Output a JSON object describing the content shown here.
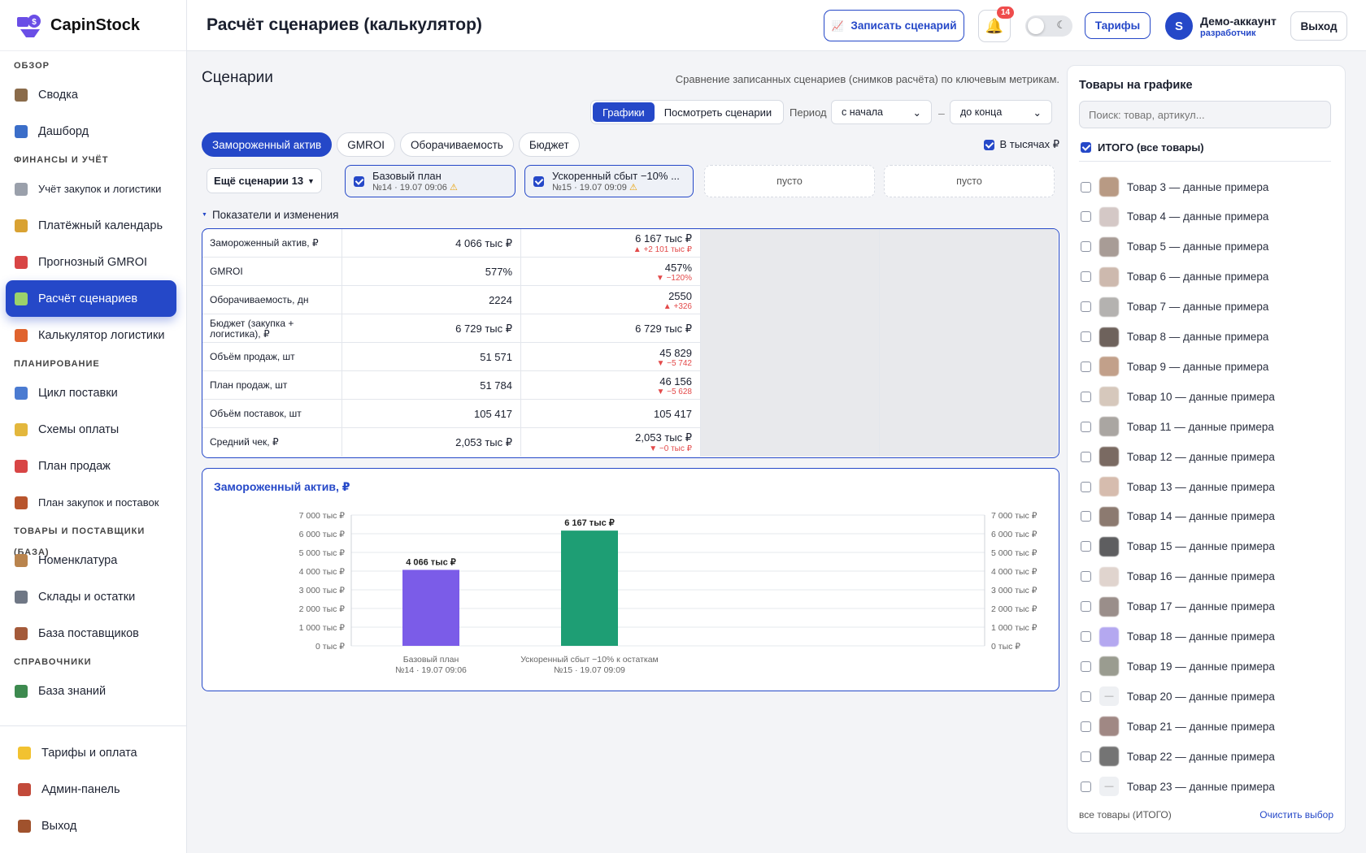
{
  "brand": {
    "name": "CapinStock"
  },
  "sidebar": {
    "sections": [
      {
        "title": "ОБЗОР",
        "items": [
          {
            "label": "Сводка",
            "icon": "notebook-icon",
            "color": "#8a6b4a"
          },
          {
            "label": "Дашборд",
            "icon": "bar-chart-icon",
            "color": "#3b6ec9"
          }
        ]
      },
      {
        "title": "ФИНАНСЫ И УЧЁТ",
        "items": [
          {
            "label": "Учёт закупок и логистики",
            "icon": "receipt-icon",
            "color": "#9aa0ab"
          },
          {
            "label": "Платёжный календарь",
            "icon": "money-bag-icon",
            "color": "#d9a233"
          },
          {
            "label": "Прогнозный GMROI",
            "icon": "target-icon",
            "color": "#d84545"
          },
          {
            "label": "Расчёт сценариев",
            "icon": "pencil-icon",
            "color": "#9bd26a",
            "active": true
          },
          {
            "label": "Калькулятор логистики",
            "icon": "truck-icon",
            "color": "#e0632e"
          }
        ]
      },
      {
        "title": "ПЛАНИРОВАНИЕ",
        "items": [
          {
            "label": "Цикл поставки",
            "icon": "cycle-icon",
            "color": "#4b7bd1"
          },
          {
            "label": "Схемы оплаты",
            "icon": "credit-card-icon",
            "color": "#e3b73d"
          },
          {
            "label": "План продаж",
            "icon": "line-chart-icon",
            "color": "#d84545"
          },
          {
            "label": "План закупок и поставок",
            "icon": "bricks-icon",
            "color": "#b8552d"
          }
        ]
      },
      {
        "title": "ТОВАРЫ И ПОСТАВЩИКИ (БАЗА)",
        "items": [
          {
            "label": "Номенклатура",
            "icon": "box-icon",
            "color": "#b9844d"
          },
          {
            "label": "Склады и остатки",
            "icon": "building-icon",
            "color": "#6f7785"
          },
          {
            "label": "База поставщиков",
            "icon": "factory-icon",
            "color": "#a45a3a"
          }
        ]
      },
      {
        "title": "СПРАВОЧНИКИ",
        "items": [
          {
            "label": "База знаний",
            "icon": "books-icon",
            "color": "#3d8a4f"
          }
        ]
      }
    ],
    "bottom": [
      {
        "label": "Тарифы и оплата",
        "icon": "star-icon",
        "color": "#f2c230"
      },
      {
        "label": "Админ-панель",
        "icon": "shield-icon",
        "color": "#c24a3a"
      },
      {
        "label": "Выход",
        "icon": "door-icon",
        "color": "#a0522d"
      }
    ]
  },
  "header": {
    "title": "Расчёт сценариев (калькулятор)",
    "record_button": "Записать сценарий",
    "notifications_count": "14",
    "tariffs_button": "Тарифы",
    "avatar_letter": "S",
    "account_name": "Демо-аккаунт",
    "account_role": "разработчик",
    "logout_button": "Выход"
  },
  "scenarios": {
    "title": "Сценарии",
    "subtitle": "Сравнение записанных сценариев (снимков расчёта) по ключевым метрикам.",
    "view_tabs": [
      "Графики",
      "Посмотреть сценарии"
    ],
    "period_label": "Период",
    "period_from": "с начала",
    "period_to": "до конца",
    "metric_tabs": [
      "Замороженный актив",
      "GMROI",
      "Оборачиваемость",
      "Бюджет"
    ],
    "thousands_label": "В тысячах ₽",
    "more_button": "Ещё сценарии 13",
    "slots": [
      {
        "name": "Базовый план",
        "meta": "№14 · 19.07 09:06"
      },
      {
        "name": "Ускоренный сбыт −10% ...",
        "meta": "№15 · 19.07 09:09"
      }
    ],
    "empty_label": "пусто",
    "metrics_header": "Показатели и изменения"
  },
  "metrics": [
    {
      "label": "Замороженный актив, ₽",
      "v1": "4 066 тыс ₽",
      "v2": "6 167 тыс ₽",
      "delta": "▲ +2 101 тыс ₽"
    },
    {
      "label": "GMROI",
      "v1": "577%",
      "v2": "457%",
      "delta": "▼ −120%"
    },
    {
      "label": "Оборачиваемость, дн",
      "v1": "2224",
      "v2": "2550",
      "delta": "▲ +326"
    },
    {
      "label": "Бюджет (закупка + логистика), ₽",
      "v1": "6 729 тыс ₽",
      "v2": "6 729 тыс ₽",
      "delta": ""
    },
    {
      "label": "Объём продаж, шт",
      "v1": "51 571",
      "v2": "45 829",
      "delta": "▼ −5 742"
    },
    {
      "label": "План продаж, шт",
      "v1": "51 784",
      "v2": "46 156",
      "delta": "▼ −5 628"
    },
    {
      "label": "Объём поставок, шт",
      "v1": "105 417",
      "v2": "105 417",
      "delta": ""
    },
    {
      "label": "Средний чек, ₽",
      "v1": "2,053 тыс ₽",
      "v2": "2,053 тыс ₽",
      "delta": "▼ −0 тыс ₽"
    }
  ],
  "chart_data": {
    "type": "bar",
    "title": "Замороженный актив, ₽",
    "categories": [
      "Базовый план",
      "Ускоренный сбыт −10% к остаткам"
    ],
    "category_sublabels": [
      "№14 · 19.07 09:06",
      "№15 · 19.07 09:09"
    ],
    "values": [
      4066,
      6167
    ],
    "value_labels": [
      "4 066 тыс ₽",
      "6 167 тыс ₽"
    ],
    "colors": [
      "#7b5ce8",
      "#1e9e74"
    ],
    "ylim": [
      0,
      7000
    ],
    "yticks": [
      "0 тыс ₽",
      "1 000 тыс ₽",
      "2 000 тыс ₽",
      "3 000 тыс ₽",
      "4 000 тыс ₽",
      "5 000 тыс ₽",
      "6 000 тыс ₽",
      "7 000 тыс ₽"
    ],
    "grid": true
  },
  "products_panel": {
    "title": "Товары на графике",
    "search_placeholder": "Поиск: товар, артикул...",
    "total_label": "ИТОГО (все товары)",
    "items": [
      {
        "label": "Товар 3 — данные примера",
        "color": "#b89a84"
      },
      {
        "label": "Товар 4 — данные примера",
        "color": "#d4c8c6"
      },
      {
        "label": "Товар 5 — данные примера",
        "color": "#a89c96"
      },
      {
        "label": "Товар 6 — данные примера",
        "color": "#cdb9ae"
      },
      {
        "label": "Товар 7 — данные примера",
        "color": "#b4b2b0"
      },
      {
        "label": "Товар 8 — данные примера",
        "color": "#6e625c"
      },
      {
        "label": "Товар 9 — данные примера",
        "color": "#c2a08a"
      },
      {
        "label": "Товар 10 — данные примера",
        "color": "#d6c8bc"
      },
      {
        "label": "Товар 11 — данные примера",
        "color": "#aaa6a2"
      },
      {
        "label": "Товар 12 — данные примера",
        "color": "#7a6a62"
      },
      {
        "label": "Товар 13 — данные примера",
        "color": "#d6bcae"
      },
      {
        "label": "Товар 14 — данные примера",
        "color": "#8c7a70"
      },
      {
        "label": "Товар 15 — данные примера",
        "color": "#5e5e60"
      },
      {
        "label": "Товар 16 — данные примера",
        "color": "#e0d4ce"
      },
      {
        "label": "Товар 17 — данные примера",
        "color": "#9a8e8a"
      },
      {
        "label": "Товар 18 — данные примера",
        "color": "#b4a8f0"
      },
      {
        "label": "Товар 19 — данные примера",
        "color": "#9a9c90"
      },
      {
        "label": "Товар 20 — данные примера",
        "color": "#eef0f3",
        "glyph": "—"
      },
      {
        "label": "Товар 21 — данные примера",
        "color": "#a08884"
      },
      {
        "label": "Товар 22 — данные примера",
        "color": "#747474"
      },
      {
        "label": "Товар 23 — данные примера",
        "color": "#eef0f3",
        "glyph": "—"
      }
    ],
    "footer_left": "все товары (ИТОГО)",
    "footer_right": "Очистить выбор"
  },
  "colors": {
    "accent": "#2548c8",
    "negative": "#e34a4a",
    "warning": "#e8a000"
  }
}
